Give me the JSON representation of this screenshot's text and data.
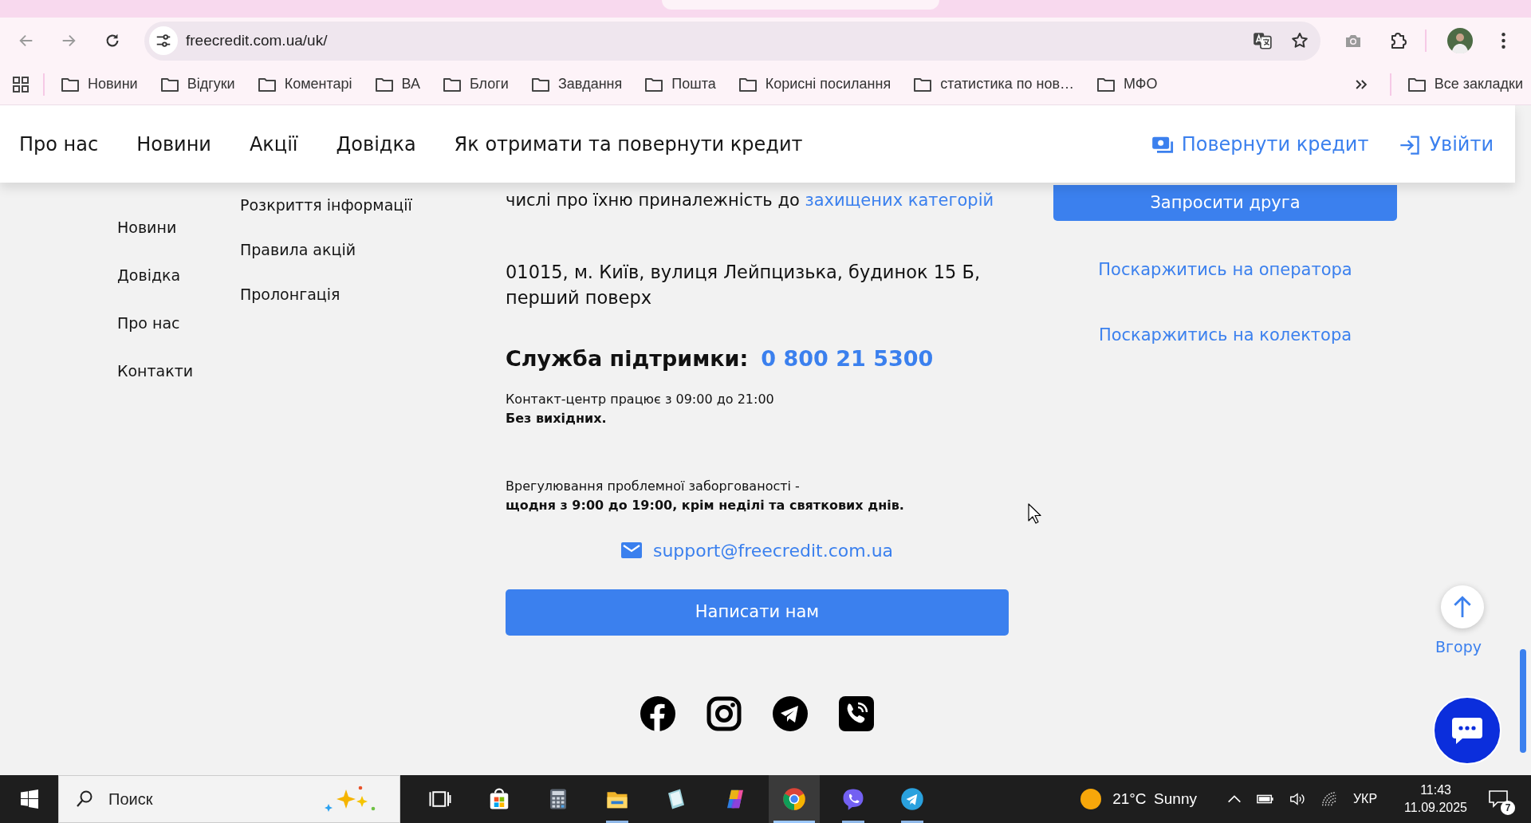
{
  "browser": {
    "url": "freecredit.com.ua/uk/",
    "bookmarks": [
      "Новини",
      "Відгуки",
      "Коментарі",
      "ВА",
      "Блоги",
      "Завдання",
      "Пошта",
      "Корисні посилання",
      "статистика по нов…",
      "МФО"
    ],
    "all_bookmarks": "Все закладки"
  },
  "site_header": {
    "nav": [
      "Про нас",
      "Новини",
      "Акції",
      "Довідка",
      "Як отримати та повернути кредит"
    ],
    "actions": [
      {
        "kind": "repay",
        "label": "Повернути кредит"
      },
      {
        "kind": "login",
        "label": "Увійти"
      }
    ]
  },
  "footer": {
    "menu_1": [
      "Новини",
      "Довідка",
      "Про нас",
      "Контакти"
    ],
    "menu_2": [
      "Розкриття інформації",
      "Правила акцій",
      "Пролонгація"
    ],
    "privacy_note": {
      "text": "числі про їхню приналежність до",
      "link": "захищених категорій"
    },
    "address": "01015, м. Київ, вулиця Лейпцизька, будинок 15 Б, перший поверх",
    "support": {
      "label": "Служба підтримки:",
      "phone": "0 800 21 5300"
    },
    "hours": "Контакт-центр працює з 09:00 до 21:00",
    "days_off": "Без вихідних.",
    "debt": {
      "label": "Врегулювання проблемної заборгованості -",
      "hours": "щодня з 9:00 до 19:00, крім неділі та святкових днів."
    },
    "email": "support@freecredit.com.ua",
    "write_button": "Написати нам",
    "invite_button": "Запросити друга",
    "complaints": [
      "Поскаржитись на оператора",
      "Поскаржитись на колектора"
    ]
  },
  "to_top": "Вгору",
  "taskbar": {
    "search": {
      "placeholder": "Поиск"
    },
    "apps": [
      {
        "kind": "task-view",
        "running": false,
        "selected": false
      },
      {
        "kind": "store",
        "running": false,
        "selected": false
      },
      {
        "kind": "calculator",
        "running": false,
        "selected": false
      },
      {
        "kind": "folder",
        "running": true,
        "selected": false
      },
      {
        "kind": "notes",
        "running": false,
        "selected": false
      },
      {
        "kind": "copilot",
        "running": false,
        "selected": false
      },
      {
        "kind": "chrome",
        "running": true,
        "selected": true
      },
      {
        "kind": "viber",
        "running": true,
        "selected": false
      },
      {
        "kind": "telegram",
        "running": true,
        "selected": false
      }
    ],
    "weather": {
      "temp": "21°C",
      "condition": "Sunny"
    },
    "language": "УКР",
    "time": "11:43",
    "date": "11.09.2025",
    "notifications": "7"
  }
}
